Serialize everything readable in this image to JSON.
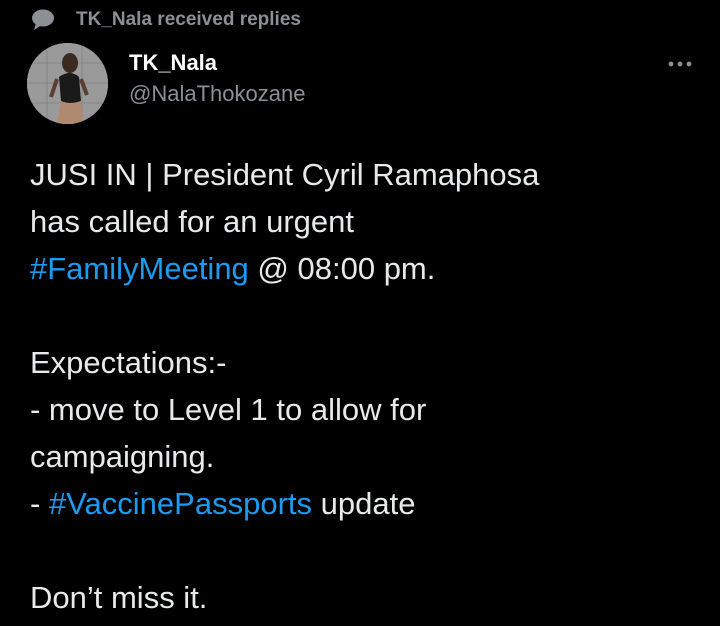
{
  "context": {
    "icon": "speech-bubble-icon",
    "text": "TK_Nala received replies"
  },
  "author": {
    "avatar": "profile-photo",
    "display_name": "TK_Nala",
    "handle": "@NalaThokozane"
  },
  "more_menu_icon": "more-horizontal-icon",
  "tweet": {
    "line1": "JUSI IN | President Cyril Ramaphosa",
    "line2": "has called for an urgent",
    "hashtag1": "#FamilyMeeting",
    "line3_rest": " @ 08:00 pm.",
    "line4": "Expectations:-",
    "line5": "- move to Level 1 to allow for",
    "line6": "campaigning.",
    "line7_prefix": "- ",
    "hashtag2": "#VaccinePassports",
    "line7_rest": " update",
    "line8": "Don’t miss it."
  },
  "colors": {
    "background": "#000000",
    "text": "#e7e9ea",
    "secondary": "#8b9096",
    "link": "#1d9bf0"
  }
}
